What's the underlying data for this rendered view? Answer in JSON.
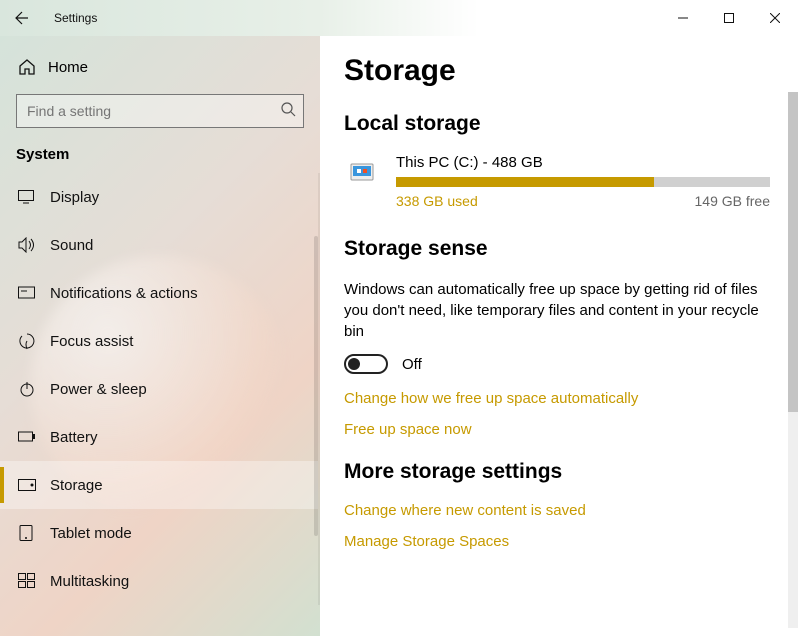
{
  "titlebar": {
    "title": "Settings"
  },
  "sidebar": {
    "home": "Home",
    "search_placeholder": "Find a setting",
    "group": "System",
    "items": [
      {
        "label": "Display"
      },
      {
        "label": "Sound"
      },
      {
        "label": "Notifications & actions"
      },
      {
        "label": "Focus assist"
      },
      {
        "label": "Power & sleep"
      },
      {
        "label": "Battery"
      },
      {
        "label": "Storage"
      },
      {
        "label": "Tablet mode"
      },
      {
        "label": "Multitasking"
      }
    ],
    "active_index": 6
  },
  "main": {
    "heading": "Storage",
    "section1": "Local storage",
    "drive": {
      "name": "This PC (C:) - 488 GB",
      "used": "338 GB used",
      "free": "149 GB free",
      "percent": 69
    },
    "section2": "Storage sense",
    "sense_desc": "Windows can automatically free up space by getting rid of files you don't need, like temporary files and content in your recycle bin",
    "sense_state": "Off",
    "link_auto": "Change how we free up space automatically",
    "link_free": "Free up space now",
    "section3": "More storage settings",
    "link_where": "Change where new content is saved",
    "link_spaces": "Manage Storage Spaces"
  }
}
